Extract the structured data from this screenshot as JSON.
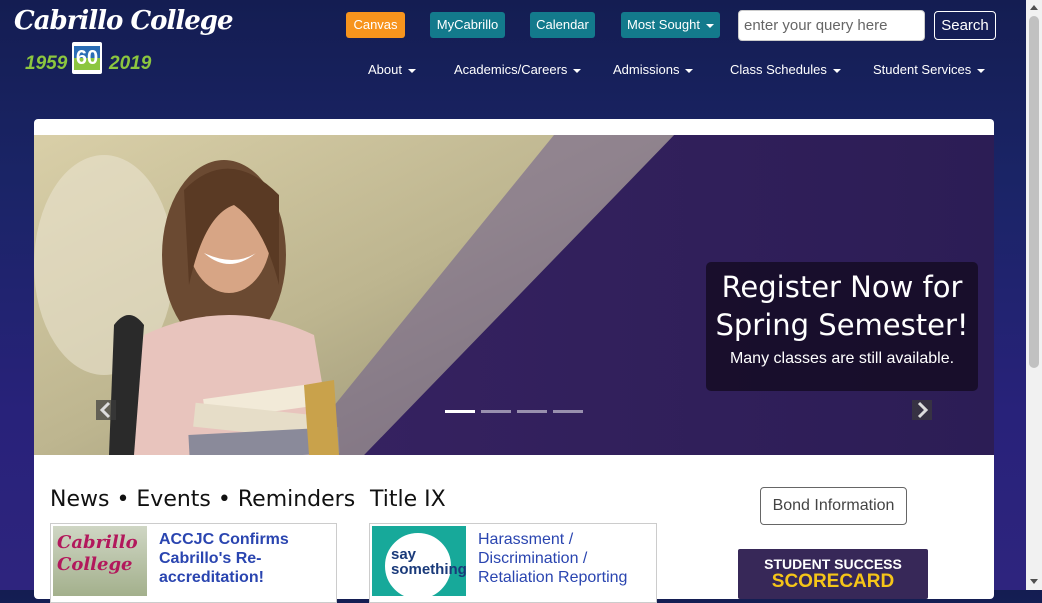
{
  "logo": {
    "script_text": "Cabrillo College",
    "year_start": "1959",
    "year_end": "2019",
    "badge": "60"
  },
  "quick_links": {
    "canvas": "Canvas",
    "mycabrillo": "MyCabrillo",
    "calendar": "Calendar",
    "most_sought": "Most Sought"
  },
  "search": {
    "placeholder": "enter your query here",
    "button_label": "Search"
  },
  "nav": [
    "About",
    "Academics/Careers",
    "Admissions",
    "Class Schedules",
    "Student Services"
  ],
  "carousel": {
    "caption_title": "Register Now for Spring Semester!",
    "caption_subtitle": "Many classes are still available.",
    "slide_count": 4,
    "active_index": 0
  },
  "news": {
    "title": "News • Events • Reminders",
    "item_thumb_text": "Cabrillo College",
    "item_link": "ACCJC Confirms Cabrillo's Re-accreditation!"
  },
  "title_ix": {
    "title": "Title IX",
    "thumb_text": "say something!",
    "item_link": "Harassment / Discrimination / Retaliation Reporting"
  },
  "sidebar": {
    "bond_button": "Bond Information",
    "scorecard_line1": "STUDENT SUCCESS",
    "scorecard_line2": "SCORECARD"
  },
  "colors": {
    "canvas": "#f7941d",
    "teal": "#137a8c",
    "link": "#2a45b0",
    "year_green": "#8cc63f"
  }
}
